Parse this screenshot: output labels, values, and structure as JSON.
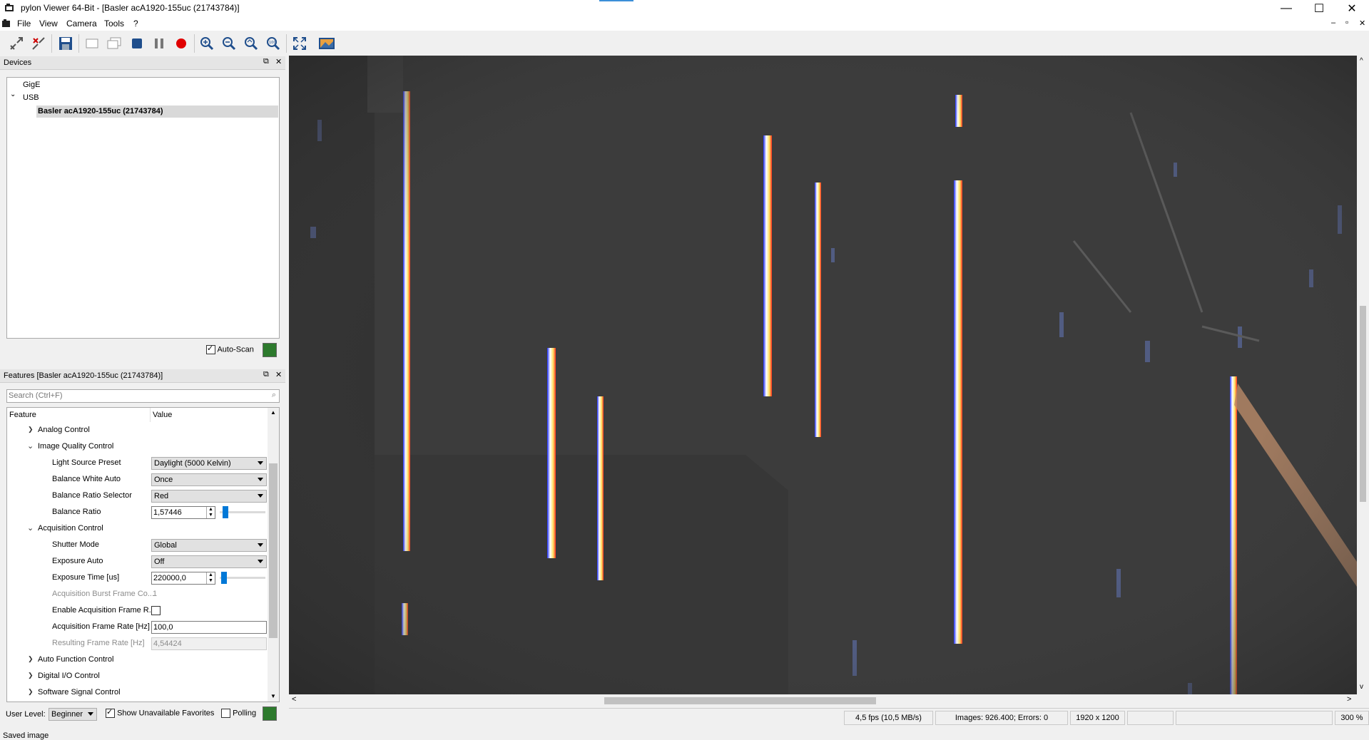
{
  "window": {
    "title": "pylon Viewer 64-Bit - [Basler acA1920-155uc (21743784)]",
    "minimize": "—",
    "maximize": "☐",
    "close": "✕",
    "mdi_min": "–",
    "mdi_restore": "▫",
    "mdi_close": "✕"
  },
  "menu": [
    "File",
    "View",
    "Camera",
    "Tools",
    "?"
  ],
  "toolbar": {
    "icons": [
      "open-camera-icon",
      "close-camera-icon",
      "save-icon",
      "single-shot-icon",
      "continuous-shot-icon",
      "stop-icon",
      "pause-icon",
      "record-icon",
      "zoom-in-icon",
      "zoom-out-icon",
      "zoom-fit-icon",
      "zoom-100-icon",
      "fullscreen-icon",
      "image-window-icon"
    ]
  },
  "devices": {
    "header": "Devices",
    "tree": [
      {
        "label": "GigE"
      },
      {
        "label": "USB",
        "expanded": true,
        "children": [
          {
            "label": "Basler acA1920-155uc (21743784)",
            "selected": true
          }
        ]
      }
    ],
    "auto_scan_label": "Auto-Scan",
    "auto_scan_checked": true
  },
  "features": {
    "header": "Features [Basler acA1920-155uc (21743784)]",
    "search_placeholder": "Search (Ctrl+F)",
    "columns": [
      "Feature",
      "Value"
    ],
    "rows": [
      {
        "name": "Analog Control",
        "type": "group",
        "expanded": false
      },
      {
        "name": "Image Quality Control",
        "type": "group",
        "expanded": true
      },
      {
        "name": "Light Source Preset",
        "value": "Daylight (5000 Kelvin)"
      },
      {
        "name": "Balance White Auto",
        "value": "Once"
      },
      {
        "name": "Balance Ratio Selector",
        "value": "Red"
      },
      {
        "name": "Balance Ratio",
        "value": "1,57446",
        "slider_fraction": 0.08
      },
      {
        "name": "Acquisition Control",
        "type": "group",
        "expanded": true
      },
      {
        "name": "Shutter Mode",
        "value": "Global"
      },
      {
        "name": "Exposure Auto",
        "value": "Off"
      },
      {
        "name": "Exposure Time [us]",
        "value": "220000,0",
        "slider_fraction": 0.03
      },
      {
        "name": "Acquisition Burst Frame Co...",
        "value": "1",
        "disabled": true
      },
      {
        "name": "Enable Acquisition Frame R...",
        "checked": false
      },
      {
        "name": "Acquisition Frame Rate [Hz]",
        "value": "100,0"
      },
      {
        "name": "Resulting Frame Rate [Hz]",
        "value": "4,54424",
        "disabled": true
      },
      {
        "name": "Auto Function Control",
        "type": "group",
        "expanded": false
      },
      {
        "name": "Digital I/O Control",
        "type": "group",
        "expanded": false
      },
      {
        "name": "Software Signal Control",
        "type": "group",
        "expanded": false
      }
    ],
    "user_level_label": "User Level:",
    "user_level_value": "Beginner",
    "show_unavailable_label": "Show Unavailable Favorites",
    "show_unavailable_checked": true,
    "polling_label": "Polling",
    "polling_checked": false
  },
  "status": {
    "fps": "4,5 fps (10,5 MB/s)",
    "images": "Images: 926.400; Errors: 0",
    "resolution": "1920 x 1200",
    "zoom": "300 %",
    "message": "Saved image"
  },
  "colors": {
    "accent": "#0078d7",
    "image_bg": "#3d3d3d",
    "record": "#e00000"
  }
}
